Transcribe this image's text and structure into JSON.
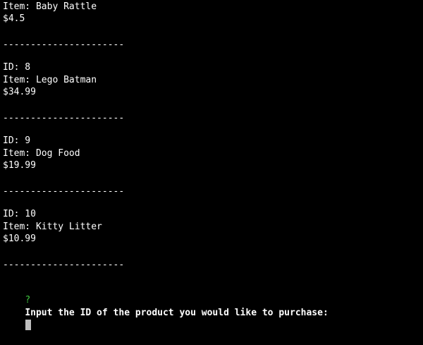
{
  "terminal": {
    "partial_record": {
      "item": "Item: Baby Rattle",
      "price": "$4.5"
    },
    "separator": "----------------------",
    "records": [
      {
        "id": "ID: 8",
        "item": "Item: Lego Batman",
        "price": "$34.99"
      },
      {
        "id": "ID: 9",
        "item": "Item: Dog Food",
        "price": "$19.99"
      },
      {
        "id": "ID: 10",
        "item": "Item: Kitty Litter",
        "price": "$10.99"
      }
    ],
    "prompt": {
      "mark": "?",
      "text": "Input the ID of the product you would like to purchase:",
      "value": ""
    }
  },
  "colors": {
    "background": "#000000",
    "text": "#ffffff",
    "prompt_mark": "#3fc43f",
    "cursor": "#bfbfbf"
  }
}
